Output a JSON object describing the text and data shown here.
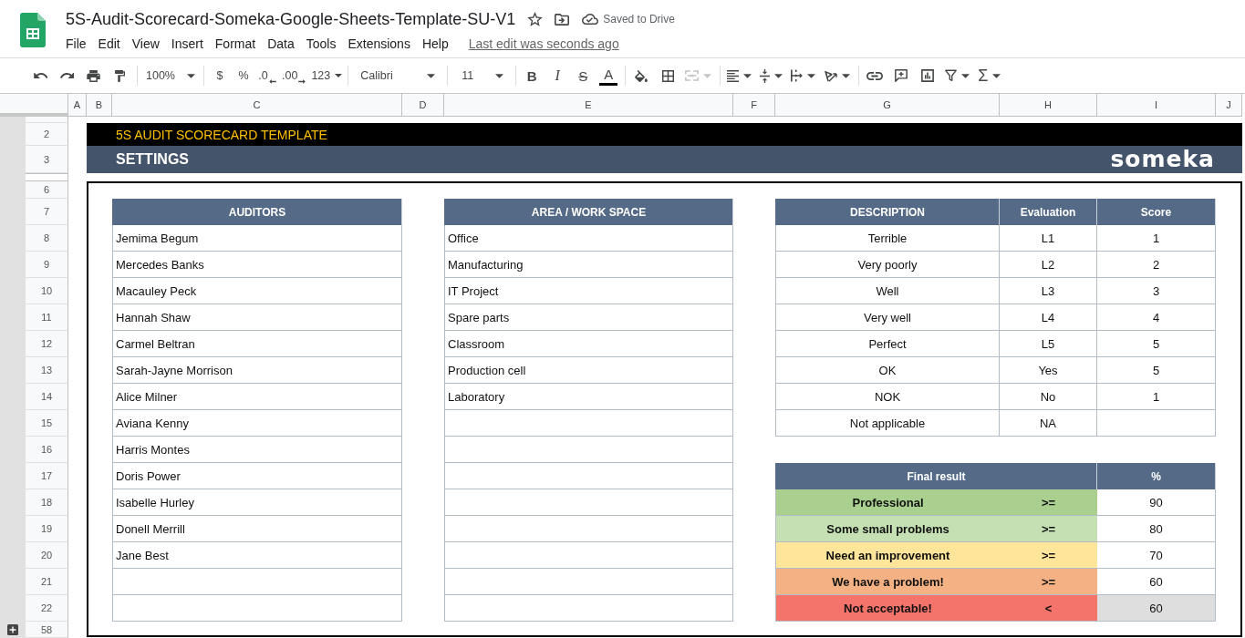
{
  "document": {
    "title": "5S-Audit-Scorecard-Someka-Google-Sheets-Template-SU-V1",
    "save_status": "Saved to Drive"
  },
  "menu": [
    "File",
    "Edit",
    "View",
    "Insert",
    "Format",
    "Data",
    "Tools",
    "Extensions",
    "Help"
  ],
  "last_edit": "Last edit was seconds ago",
  "toolbar": {
    "zoom": "100%",
    "currency": "$",
    "percent": "%",
    "decimal_decrease": ".0",
    "decimal_increase": ".00",
    "number_format": "123",
    "font": "Calibri",
    "font_size": "11",
    "bold": "B",
    "italic": "I",
    "strikethrough": "S",
    "text_color": "A",
    "merge": {
      "disabled": true
    },
    "sum": "Σ"
  },
  "sheet": {
    "column_headers": [
      "A",
      "B",
      "C",
      "D",
      "E",
      "F",
      "G",
      "H",
      "I",
      "J"
    ],
    "row_numbers": [
      "2",
      "3",
      "6",
      "7",
      "8",
      "9",
      "10",
      "11",
      "12",
      "13",
      "14",
      "15",
      "16",
      "17",
      "18",
      "19",
      "20",
      "21",
      "22",
      "58"
    ],
    "title": "5S AUDIT SCORECARD TEMPLATE",
    "section": "SETTINGS",
    "brand": "someka",
    "auditors": {
      "header": "AUDITORS",
      "rows": [
        "Jemima Begum",
        "Mercedes Banks",
        "Macauley Peck",
        "Hannah Shaw",
        "Carmel Beltran",
        "Sarah-Jayne Morrison",
        "Alice Milner",
        "Aviana Kenny",
        "Harris Montes",
        "Doris Power",
        "Isabelle Hurley",
        "Donell Merrill",
        "Jane Best"
      ]
    },
    "areas": {
      "header": "AREA / WORK SPACE",
      "rows": [
        "Office",
        "Manufacturing",
        "IT Project",
        "Spare parts",
        "Classroom",
        "Production cell",
        "Laboratory"
      ]
    },
    "evaluation": {
      "columns": [
        "DESCRIPTION",
        "Evaluation",
        "Score"
      ],
      "rows": [
        {
          "description": "Terrible",
          "evaluation": "L1",
          "score": "1"
        },
        {
          "description": "Very poorly",
          "evaluation": "L2",
          "score": "2"
        },
        {
          "description": "Well",
          "evaluation": "L3",
          "score": "3"
        },
        {
          "description": "Very well",
          "evaluation": "L4",
          "score": "4"
        },
        {
          "description": "Perfect",
          "evaluation": "L5",
          "score": "5"
        },
        {
          "description": "OK",
          "evaluation": "Yes",
          "score": "5"
        },
        {
          "description": "NOK",
          "evaluation": "No",
          "score": "1"
        },
        {
          "description": "Not applicable",
          "evaluation": "NA"
        }
      ]
    },
    "final_result": {
      "columns": [
        "Final result",
        "%"
      ],
      "rows": [
        {
          "label": "Professional",
          "operator": ">=",
          "percent": "90",
          "color": "#a9d08e",
          "shaded": false
        },
        {
          "label": "Some small problems",
          "operator": ">=",
          "percent": "80",
          "color": "#c5e0b3",
          "shaded": false
        },
        {
          "label": "Need an improvement",
          "operator": ">=",
          "percent": "70",
          "color": "#ffe599",
          "shaded": false
        },
        {
          "label": "We have a problem!",
          "operator": ">=",
          "percent": "60",
          "color": "#f4b183",
          "shaded": false
        },
        {
          "label": "Not acceptable!",
          "operator": "<",
          "percent": "60",
          "color": "#f4736b",
          "shaded": true
        }
      ]
    }
  }
}
